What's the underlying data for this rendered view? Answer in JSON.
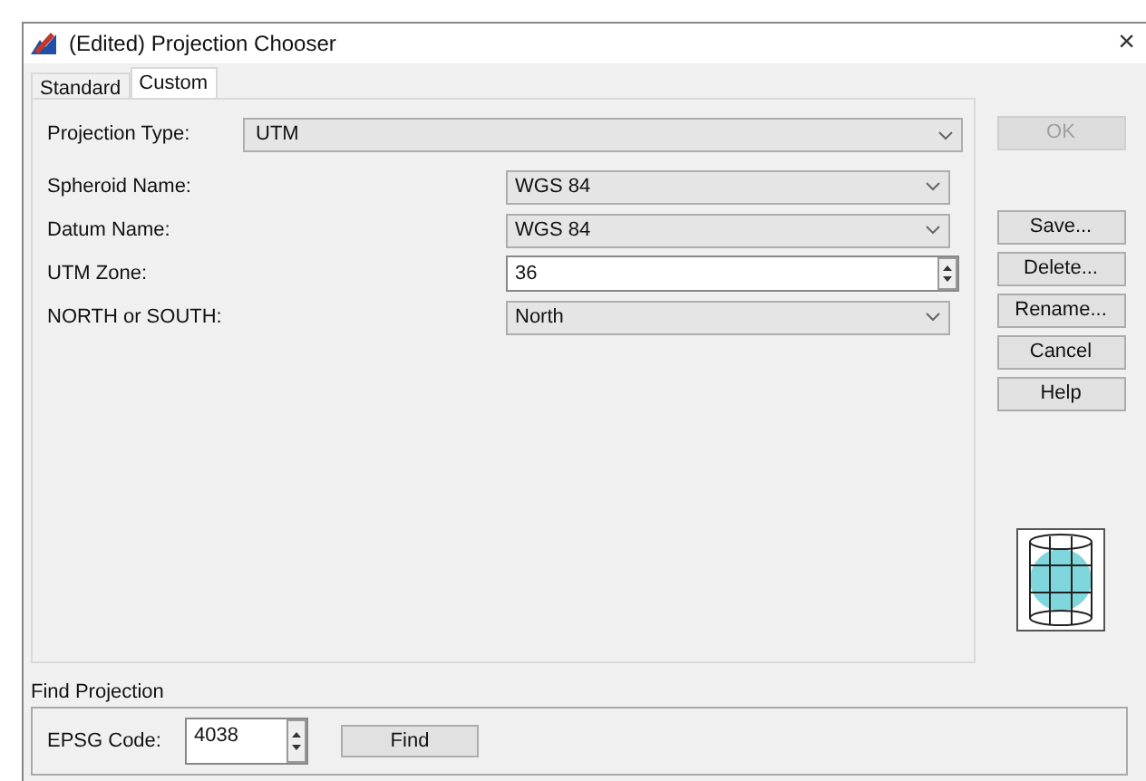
{
  "window": {
    "title": "(Edited) Projection Chooser",
    "close": "×"
  },
  "tabs": [
    {
      "label": "Standard",
      "selected": false
    },
    {
      "label": "Custom",
      "selected": true
    }
  ],
  "projection_type": {
    "label": "Projection Type:",
    "value": "UTM"
  },
  "fields": [
    {
      "kind": "combo",
      "label": "Spheroid Name:",
      "value": "WGS 84"
    },
    {
      "kind": "combo",
      "label": "Datum Name:",
      "value": "WGS 84"
    },
    {
      "kind": "spin",
      "label": "UTM Zone:",
      "value": "36"
    },
    {
      "kind": "combo",
      "label": "NORTH or SOUTH:",
      "value": "North"
    }
  ],
  "buttons": [
    {
      "label": "OK",
      "disabled": true
    },
    {
      "label": "Save...",
      "disabled": false
    },
    {
      "label": "Delete...",
      "disabled": false
    },
    {
      "label": "Rename...",
      "disabled": false
    },
    {
      "label": "Cancel",
      "disabled": false
    },
    {
      "label": "Help",
      "disabled": false
    }
  ],
  "find_projection": {
    "title": "Find Projection",
    "label": "EPSG Code:",
    "value": "4038",
    "button": "Find"
  }
}
